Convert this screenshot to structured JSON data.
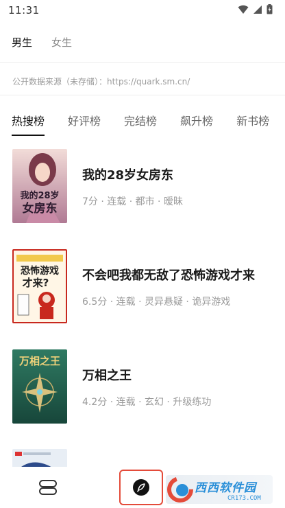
{
  "status_bar": {
    "time": "11:31",
    "icons": [
      "wifi-icon",
      "signal-icon",
      "battery-icon"
    ]
  },
  "gender_tabs": [
    {
      "label": "男生",
      "active": true
    },
    {
      "label": "女生",
      "active": false
    }
  ],
  "source_note": "公开数据来源（未存储）：https://quark.sm.cn/",
  "rank_tabs": [
    {
      "label": "热搜榜",
      "active": true
    },
    {
      "label": "好评榜",
      "active": false
    },
    {
      "label": "完结榜",
      "active": false
    },
    {
      "label": "飙升榜",
      "active": false
    },
    {
      "label": "新书榜",
      "active": false
    }
  ],
  "books": [
    {
      "title": "我的28岁女房东",
      "meta": "7分 · 连载 · 都市 · 暧昧",
      "cover_text": "我的28岁女房东",
      "cover_colors": [
        "#e9c7c9",
        "#8a5a7a"
      ]
    },
    {
      "title": "不会吧我都无敌了恐怖游戏才来",
      "meta": "6.5分 · 连载 · 灵异悬疑 · 诡异游戏",
      "cover_text": "恐怖游戏才来",
      "cover_colors": [
        "#fff6e6",
        "#c8281e"
      ]
    },
    {
      "title": "万相之王",
      "meta": "4.2分 · 连载 · 玄幻 · 升级练功",
      "cover_text": "万相之王",
      "cover_colors": [
        "#2f7a62",
        "#17463a"
      ]
    },
    {
      "title": "",
      "meta": "",
      "cover_text": "",
      "cover_colors": [
        "#e8eef5",
        "#2c4a8a"
      ]
    }
  ],
  "bottom_nav": {
    "items": [
      "menu-icon",
      "discover-icon"
    ],
    "highlight_color": "#e44b3a"
  },
  "watermark": {
    "main": "西西软件园",
    "sub": "CR173.COM"
  }
}
